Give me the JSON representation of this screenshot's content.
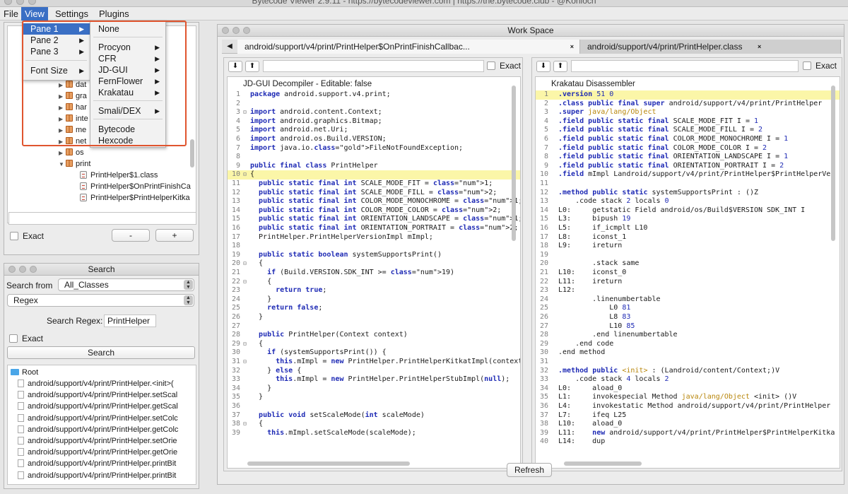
{
  "os_title": "Bytecode Viewer 2.9.11 - https://bytecodeviewer.com | https://the.bytecode.club - @Konloch",
  "menubar": {
    "file": "File",
    "view": "View",
    "settings": "Settings",
    "plugins": "Plugins"
  },
  "view_menu": {
    "items": [
      {
        "label": "Pane 1",
        "submenu": true
      },
      {
        "label": "Pane 2",
        "submenu": true
      },
      {
        "label": "Pane 3",
        "submenu": true
      },
      {
        "label": "Font Size",
        "submenu": true
      }
    ]
  },
  "pane1_menu": {
    "items": [
      {
        "label": "None",
        "submenu": false
      },
      {
        "label": "Procyon",
        "submenu": true
      },
      {
        "label": "CFR",
        "submenu": true
      },
      {
        "label": "JD-GUI",
        "submenu": true
      },
      {
        "label": "FernFlower",
        "submenu": true
      },
      {
        "label": "Krakatau",
        "submenu": true
      },
      {
        "label": "Smali/DEX",
        "submenu": true
      },
      {
        "label": "Bytecode",
        "submenu": false
      },
      {
        "label": "Hexcode",
        "submenu": false
      }
    ]
  },
  "tree": {
    "packages": [
      "dat",
      "gra",
      "har",
      "inte",
      "me",
      "net",
      "os",
      "print"
    ],
    "classes": [
      "PrintHelper$1.class",
      "PrintHelper$OnPrintFinishCa",
      "PrintHelper$PrintHelperKitka"
    ],
    "exact_label": "Exact",
    "minus_label": "-",
    "plus_label": "+"
  },
  "search": {
    "title": "Search",
    "search_from_label": "Search from",
    "search_from_value": "All_Classes",
    "mode_value": "Regex",
    "regex_label": "Search Regex:",
    "regex_value": "PrintHelper",
    "exact_label": "Exact",
    "button_label": "Search",
    "root_label": "Root",
    "results": [
      "android/support/v4/print/PrintHelper.<init>(",
      "android/support/v4/print/PrintHelper.setScal",
      "android/support/v4/print/PrintHelper.getScal",
      "android/support/v4/print/PrintHelper.setColc",
      "android/support/v4/print/PrintHelper.getColc",
      "android/support/v4/print/PrintHelper.setOrie",
      "android/support/v4/print/PrintHelper.getOrie",
      "android/support/v4/print/PrintHelper.printBit",
      "android/support/v4/print/PrintHelper.printBit"
    ]
  },
  "workspace": {
    "title": "Work Space",
    "tab_nav": "◀",
    "tabs": [
      {
        "label": "android/support/v4/print/PrintHelper$OnPrintFinishCallbac...",
        "close": "×"
      },
      {
        "label": "android/support/v4/print/PrintHelper.class",
        "close": "×"
      }
    ],
    "left_pane": {
      "header": "JD-GUI Decompiler - Editable: false",
      "exact_label": "Exact",
      "highlight_line": 10,
      "lines": [
        "package android.support.v4.print;",
        "",
        "import android.content.Context;",
        "import android.graphics.Bitmap;",
        "import android.net.Uri;",
        "import android.os.Build.VERSION;",
        "import java.io.FileNotFoundException;",
        "",
        "public final class PrintHelper",
        "{",
        "  public static final int SCALE_MODE_FIT = 1;",
        "  public static final int SCALE_MODE_FILL = 2;",
        "  public static final int COLOR_MODE_MONOCHROME = 1;",
        "  public static final int COLOR_MODE_COLOR = 2;",
        "  public static final int ORIENTATION_LANDSCAPE = 1;",
        "  public static final int ORIENTATION_PORTRAIT = 2;",
        "  PrintHelper.PrintHelperVersionImpl mImpl;",
        "",
        "  public static boolean systemSupportsPrint()",
        "  {",
        "    if (Build.VERSION.SDK_INT >= 19)",
        "    {",
        "      return true;",
        "    }",
        "    return false;",
        "  }",
        "",
        "  public PrintHelper(Context context)",
        "  {",
        "    if (systemSupportsPrint()) {",
        "      this.mImpl = new PrintHelper.PrintHelperKitkatImpl(context",
        "    } else {",
        "      this.mImpl = new PrintHelper.PrintHelperStubImpl(null);",
        "    }",
        "  }",
        "",
        "  public void setScaleMode(int scaleMode)",
        "  {",
        "    this.mImpl.setScaleMode(scaleMode);"
      ]
    },
    "right_pane": {
      "header": "Krakatau Disassembler",
      "exact_label": "Exact",
      "highlight_line": 1,
      "lines": [
        ".version 51 0",
        ".class public final super android/support/v4/print/PrintHelper",
        ".super java/lang/Object",
        ".field public static final SCALE_MODE_FIT I = 1",
        ".field public static final SCALE_MODE_FILL I = 2",
        ".field public static final COLOR_MODE_MONOCHROME I = 1",
        ".field public static final COLOR_MODE_COLOR I = 2",
        ".field public static final ORIENTATION_LANDSCAPE I = 1",
        ".field public static final ORIENTATION_PORTRAIT I = 2",
        ".field mImpl Landroid/support/v4/print/PrintHelper$PrintHelperVer",
        "",
        ".method public static systemSupportsPrint : ()Z",
        "    .code stack 2 locals 0",
        "L0:     getstatic Field android/os/Build$VERSION SDK_INT I",
        "L3:     bipush 19",
        "L5:     if_icmplt L10",
        "L8:     iconst_1",
        "L9:     ireturn",
        "",
        "        .stack same",
        "L10:    iconst_0",
        "L11:    ireturn",
        "L12:",
        "        .linenumbertable",
        "            L0 81",
        "            L8 83",
        "            L10 85",
        "        .end linenumbertable",
        "    .end code",
        ".end method",
        "",
        ".method public <init> : (Landroid/content/Context;)V",
        "    .code stack 4 locals 2",
        "L0:     aload_0",
        "L1:     invokespecial Method java/lang/Object <init> ()V",
        "L4:     invokestatic Method android/support/v4/print/PrintHelper",
        "L7:     ifeq L25",
        "L10:    aload_0",
        "L11:    new android/support/v4/print/PrintHelper$PrintHelperKitka",
        "L14:    dup"
      ]
    },
    "refresh_label": "Refresh"
  },
  "colors": {
    "menu_highlight": "#3a6fc4",
    "callout_border": "#e0552f",
    "line_highlight": "#fbf6a8",
    "keyword": "#1f2bb5"
  }
}
